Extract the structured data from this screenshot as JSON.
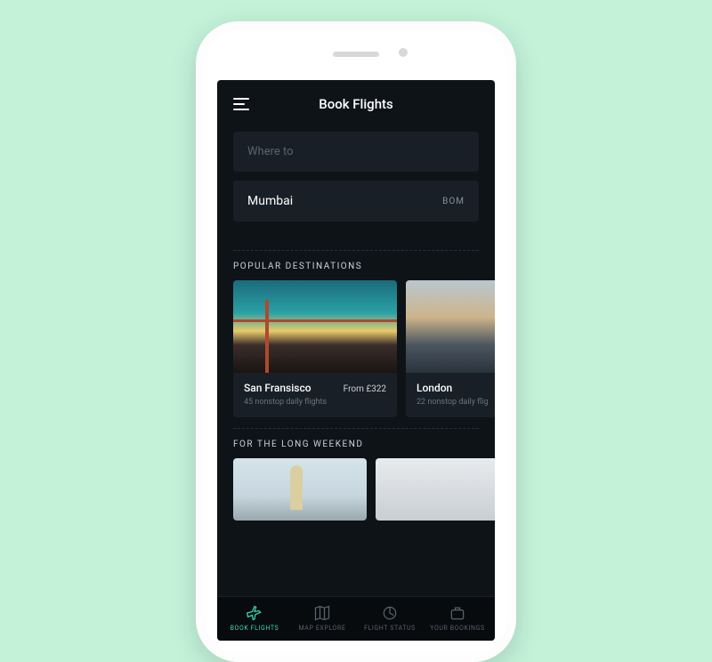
{
  "header": {
    "title": "Book Flights"
  },
  "search": {
    "where_to_placeholder": "Where to",
    "from_city": "Mumbai",
    "from_code": "BOM"
  },
  "sections": {
    "popular_title": "POPULAR DESTINATIONS",
    "weekend_title": "FOR THE LONG WEEKEND"
  },
  "popular": [
    {
      "name": "San Fransisco",
      "price": "From £322",
      "sub": "45 nonstop daily flights"
    },
    {
      "name": "London",
      "price": "",
      "sub": "22 nonstop daily flig"
    }
  ],
  "tabs": [
    {
      "label": "BOOK FLIGHTS"
    },
    {
      "label": "MAP EXPLORE"
    },
    {
      "label": "FLIGHT STATUS"
    },
    {
      "label": "YOUR BOOKINGS"
    }
  ],
  "colors": {
    "accent": "#3dd9b0",
    "bg": "#0e1318",
    "card": "#191f26"
  }
}
